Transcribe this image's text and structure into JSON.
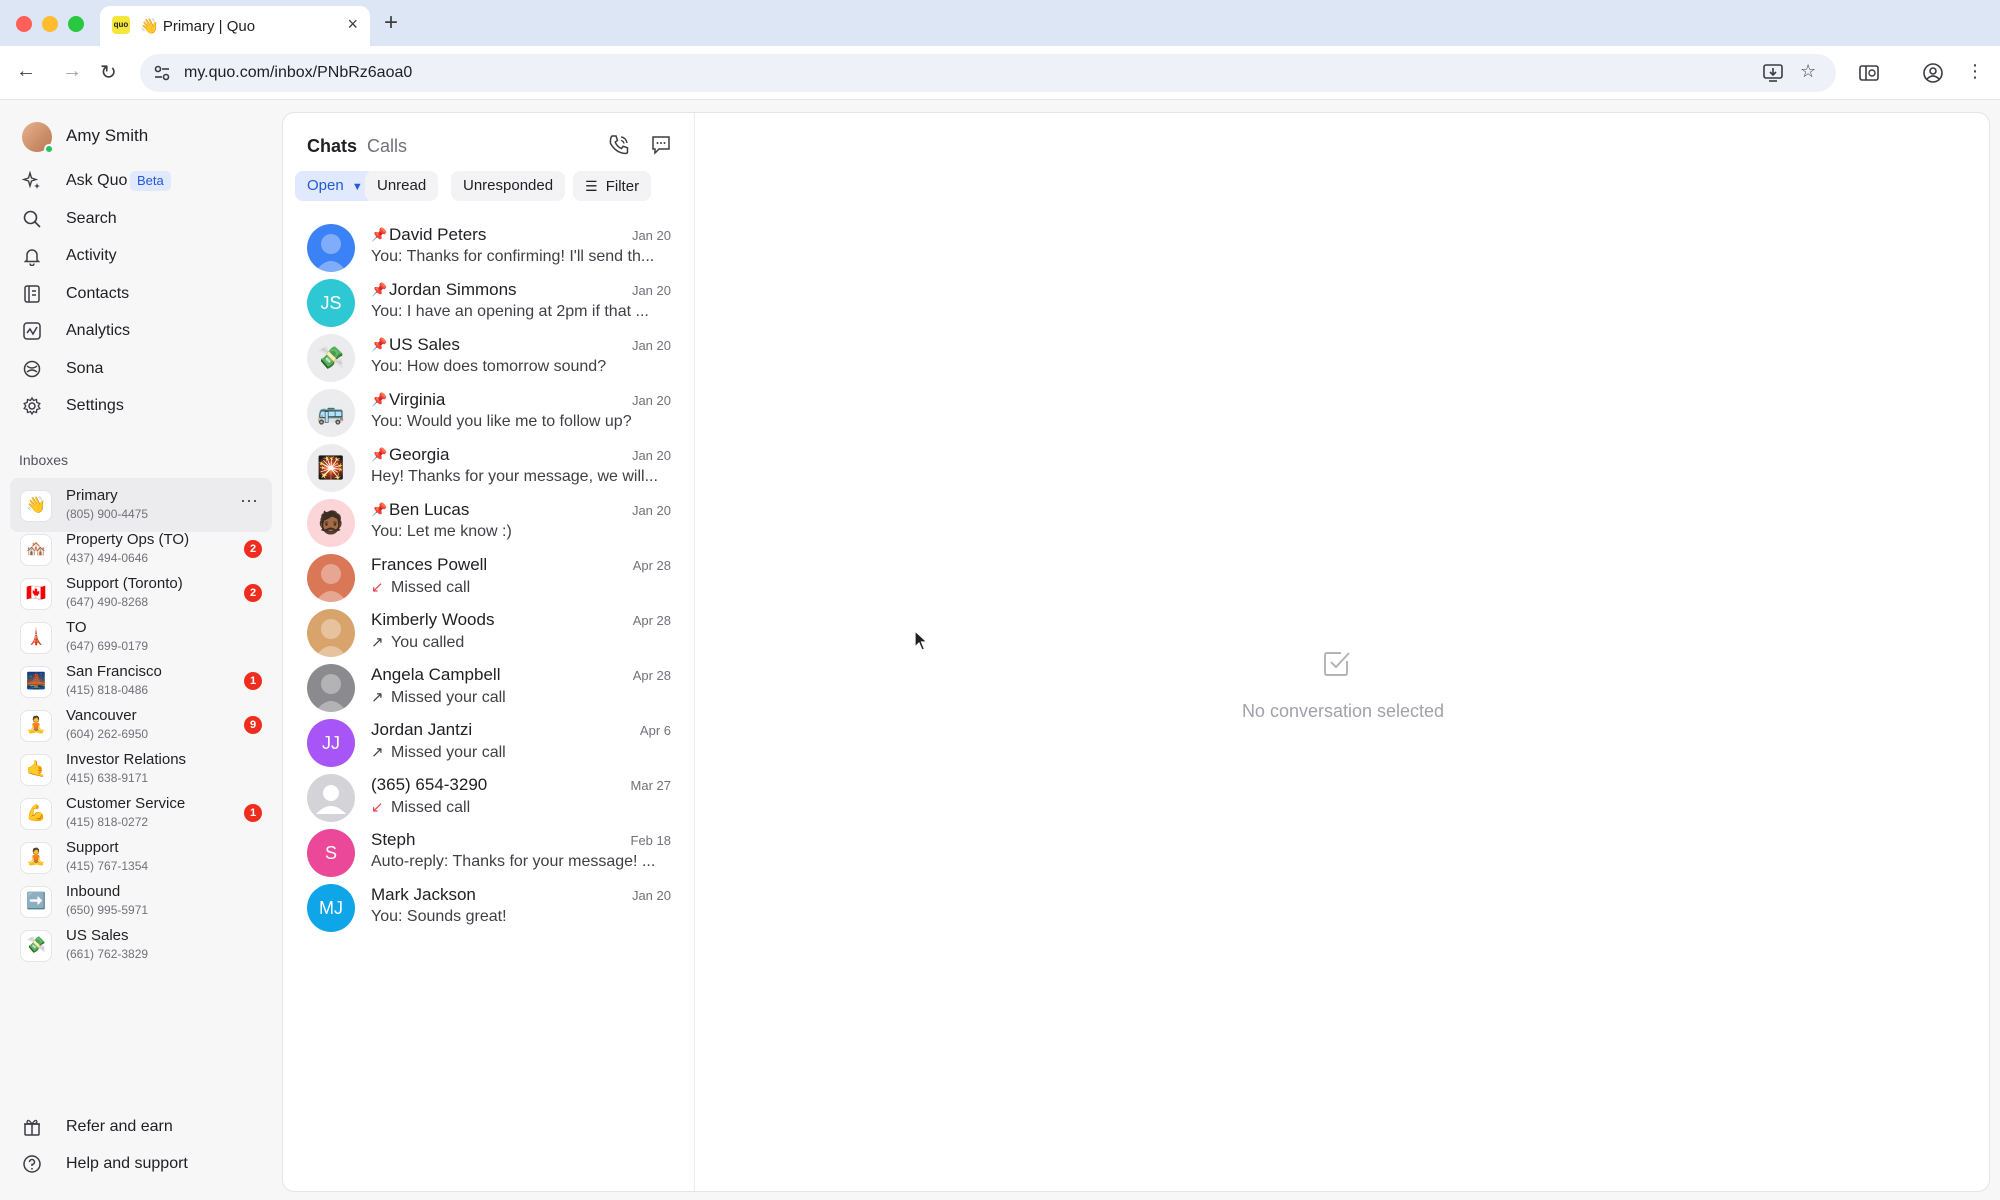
{
  "browser": {
    "tab_title": "👋 Primary | Quo",
    "favicon_text": "quo",
    "url": "my.quo.com/inbox/PNbRz6aoa0"
  },
  "sidebar": {
    "user_name": "Amy Smith",
    "nav": [
      {
        "label": "Ask Quo",
        "icon": "sparkle-icon",
        "badge": "Beta"
      },
      {
        "label": "Search",
        "icon": "search-icon"
      },
      {
        "label": "Activity",
        "icon": "bell-icon"
      },
      {
        "label": "Contacts",
        "icon": "contacts-icon"
      },
      {
        "label": "Analytics",
        "icon": "analytics-icon"
      },
      {
        "label": "Sona",
        "icon": "sona-icon"
      },
      {
        "label": "Settings",
        "icon": "gear-icon"
      }
    ],
    "inboxes_heading": "Inboxes",
    "inboxes": [
      {
        "emoji": "👋",
        "name": "Primary",
        "phone": "(805) 900-4475",
        "active": true
      },
      {
        "emoji": "🏘️",
        "name": "Property Ops (TO)",
        "phone": "(437) 494-0646",
        "badge": "2"
      },
      {
        "emoji": "🇨🇦",
        "name": "Support (Toronto)",
        "phone": "(647) 490-8268",
        "badge": "2"
      },
      {
        "emoji": "🗼",
        "name": "TO",
        "phone": "(647) 699-0179"
      },
      {
        "emoji": "🌉",
        "name": "San Francisco",
        "phone": "(415) 818-0486",
        "badge": "1"
      },
      {
        "emoji": "🧘",
        "name": "Vancouver",
        "phone": "(604) 262-6950",
        "badge": "9"
      },
      {
        "emoji": "🤙",
        "name": "Investor Relations",
        "phone": "(415) 638-9171"
      },
      {
        "emoji": "💪",
        "name": "Customer Service",
        "phone": "(415) 818-0272",
        "badge": "1"
      },
      {
        "emoji": "🧘",
        "name": "Support",
        "phone": "(415) 767-1354"
      },
      {
        "emoji": "➡️",
        "name": "Inbound",
        "phone": "(650) 995-5971"
      },
      {
        "emoji": "💸",
        "name": "US Sales",
        "phone": "(661) 762-3829"
      }
    ],
    "footer": [
      {
        "label": "Refer and earn",
        "icon": "gift-icon"
      },
      {
        "label": "Help and support",
        "icon": "help-icon"
      }
    ]
  },
  "conversations_panel": {
    "tabs": [
      "Chats",
      "Calls"
    ],
    "filters": [
      "Open",
      "Unread",
      "Unresponded",
      "Filter"
    ],
    "items": [
      {
        "name": "David Peters",
        "pinned": true,
        "date": "Jan 20",
        "preview": "You: Thanks for confirming! I'll send th...",
        "avatar_color": "#3b82f6"
      },
      {
        "name": "Jordan Simmons",
        "pinned": true,
        "date": "Jan 20",
        "preview": "You: I have an opening at 2pm if that ...",
        "initials": "JS",
        "avatar_color": "#2dc8d4"
      },
      {
        "name": "US Sales",
        "pinned": true,
        "date": "Jan 20",
        "preview": "You: How does tomorrow sound?",
        "emoji": "💸",
        "avatar_color": "#ececee"
      },
      {
        "name": "Virginia",
        "pinned": true,
        "date": "Jan 20",
        "preview": "You: Would you like me to follow up?",
        "emoji": "🚌",
        "avatar_color": "#ececee"
      },
      {
        "name": "Georgia",
        "pinned": true,
        "date": "Jan 20",
        "preview": "Hey! Thanks for your message, we will...",
        "emoji": "🎇",
        "avatar_color": "#ececee"
      },
      {
        "name": "Ben Lucas",
        "pinned": true,
        "date": "Jan 20",
        "preview": "You: Let me know :)",
        "emoji": "🧔🏾",
        "avatar_color": "#fbd5d8"
      },
      {
        "name": "Frances Powell",
        "date": "Apr 28",
        "call": "missed",
        "preview": "Missed call",
        "avatar_color": "#d97757"
      },
      {
        "name": "Kimberly Woods",
        "date": "Apr 28",
        "call": "outgoing",
        "preview": "You called",
        "avatar_color": "#d9a46b"
      },
      {
        "name": "Angela Campbell",
        "date": "Apr 28",
        "call": "outgoing",
        "preview": "Missed your call",
        "avatar_color": "#8b8b8f"
      },
      {
        "name": "Jordan Jantzi",
        "date": "Apr 6",
        "call": "outgoing",
        "preview": "Missed your call",
        "initials": "JJ",
        "avatar_color": "#a855f7"
      },
      {
        "name": "(365) 654-3290",
        "date": "Mar 27",
        "call": "missed",
        "preview": "Missed call",
        "placeholder": true,
        "avatar_color": "#d4d4d8"
      },
      {
        "name": "Steph",
        "date": "Feb 18",
        "preview": "Auto-reply: Thanks for your message! ...",
        "initials": "S",
        "avatar_color": "#ec4899"
      },
      {
        "name": "Mark Jackson",
        "date": "Jan 20",
        "preview": "You: Sounds great!",
        "initials": "MJ",
        "avatar_color": "#0ea5e9"
      }
    ]
  },
  "empty_state": {
    "text": "No conversation selected"
  }
}
